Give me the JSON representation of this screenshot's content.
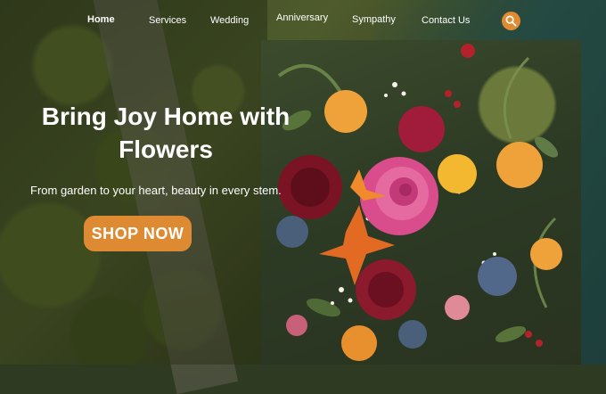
{
  "nav": {
    "items": [
      {
        "label": "Home",
        "active": true
      },
      {
        "label": "Services",
        "active": false
      },
      {
        "label": "Wedding",
        "active": false
      },
      {
        "label": "Anniversary",
        "active": false
      },
      {
        "label": "Sympathy",
        "active": false
      },
      {
        "label": "Contact Us",
        "active": false
      }
    ],
    "search_icon": "search-icon"
  },
  "hero": {
    "title": "Bring Joy Home with Flowers",
    "subtitle": "From garden to your heart, beauty in every stem.",
    "cta_label": "SHOP NOW"
  },
  "colors": {
    "accent": "#dd8a33",
    "text": "#ffffff"
  }
}
